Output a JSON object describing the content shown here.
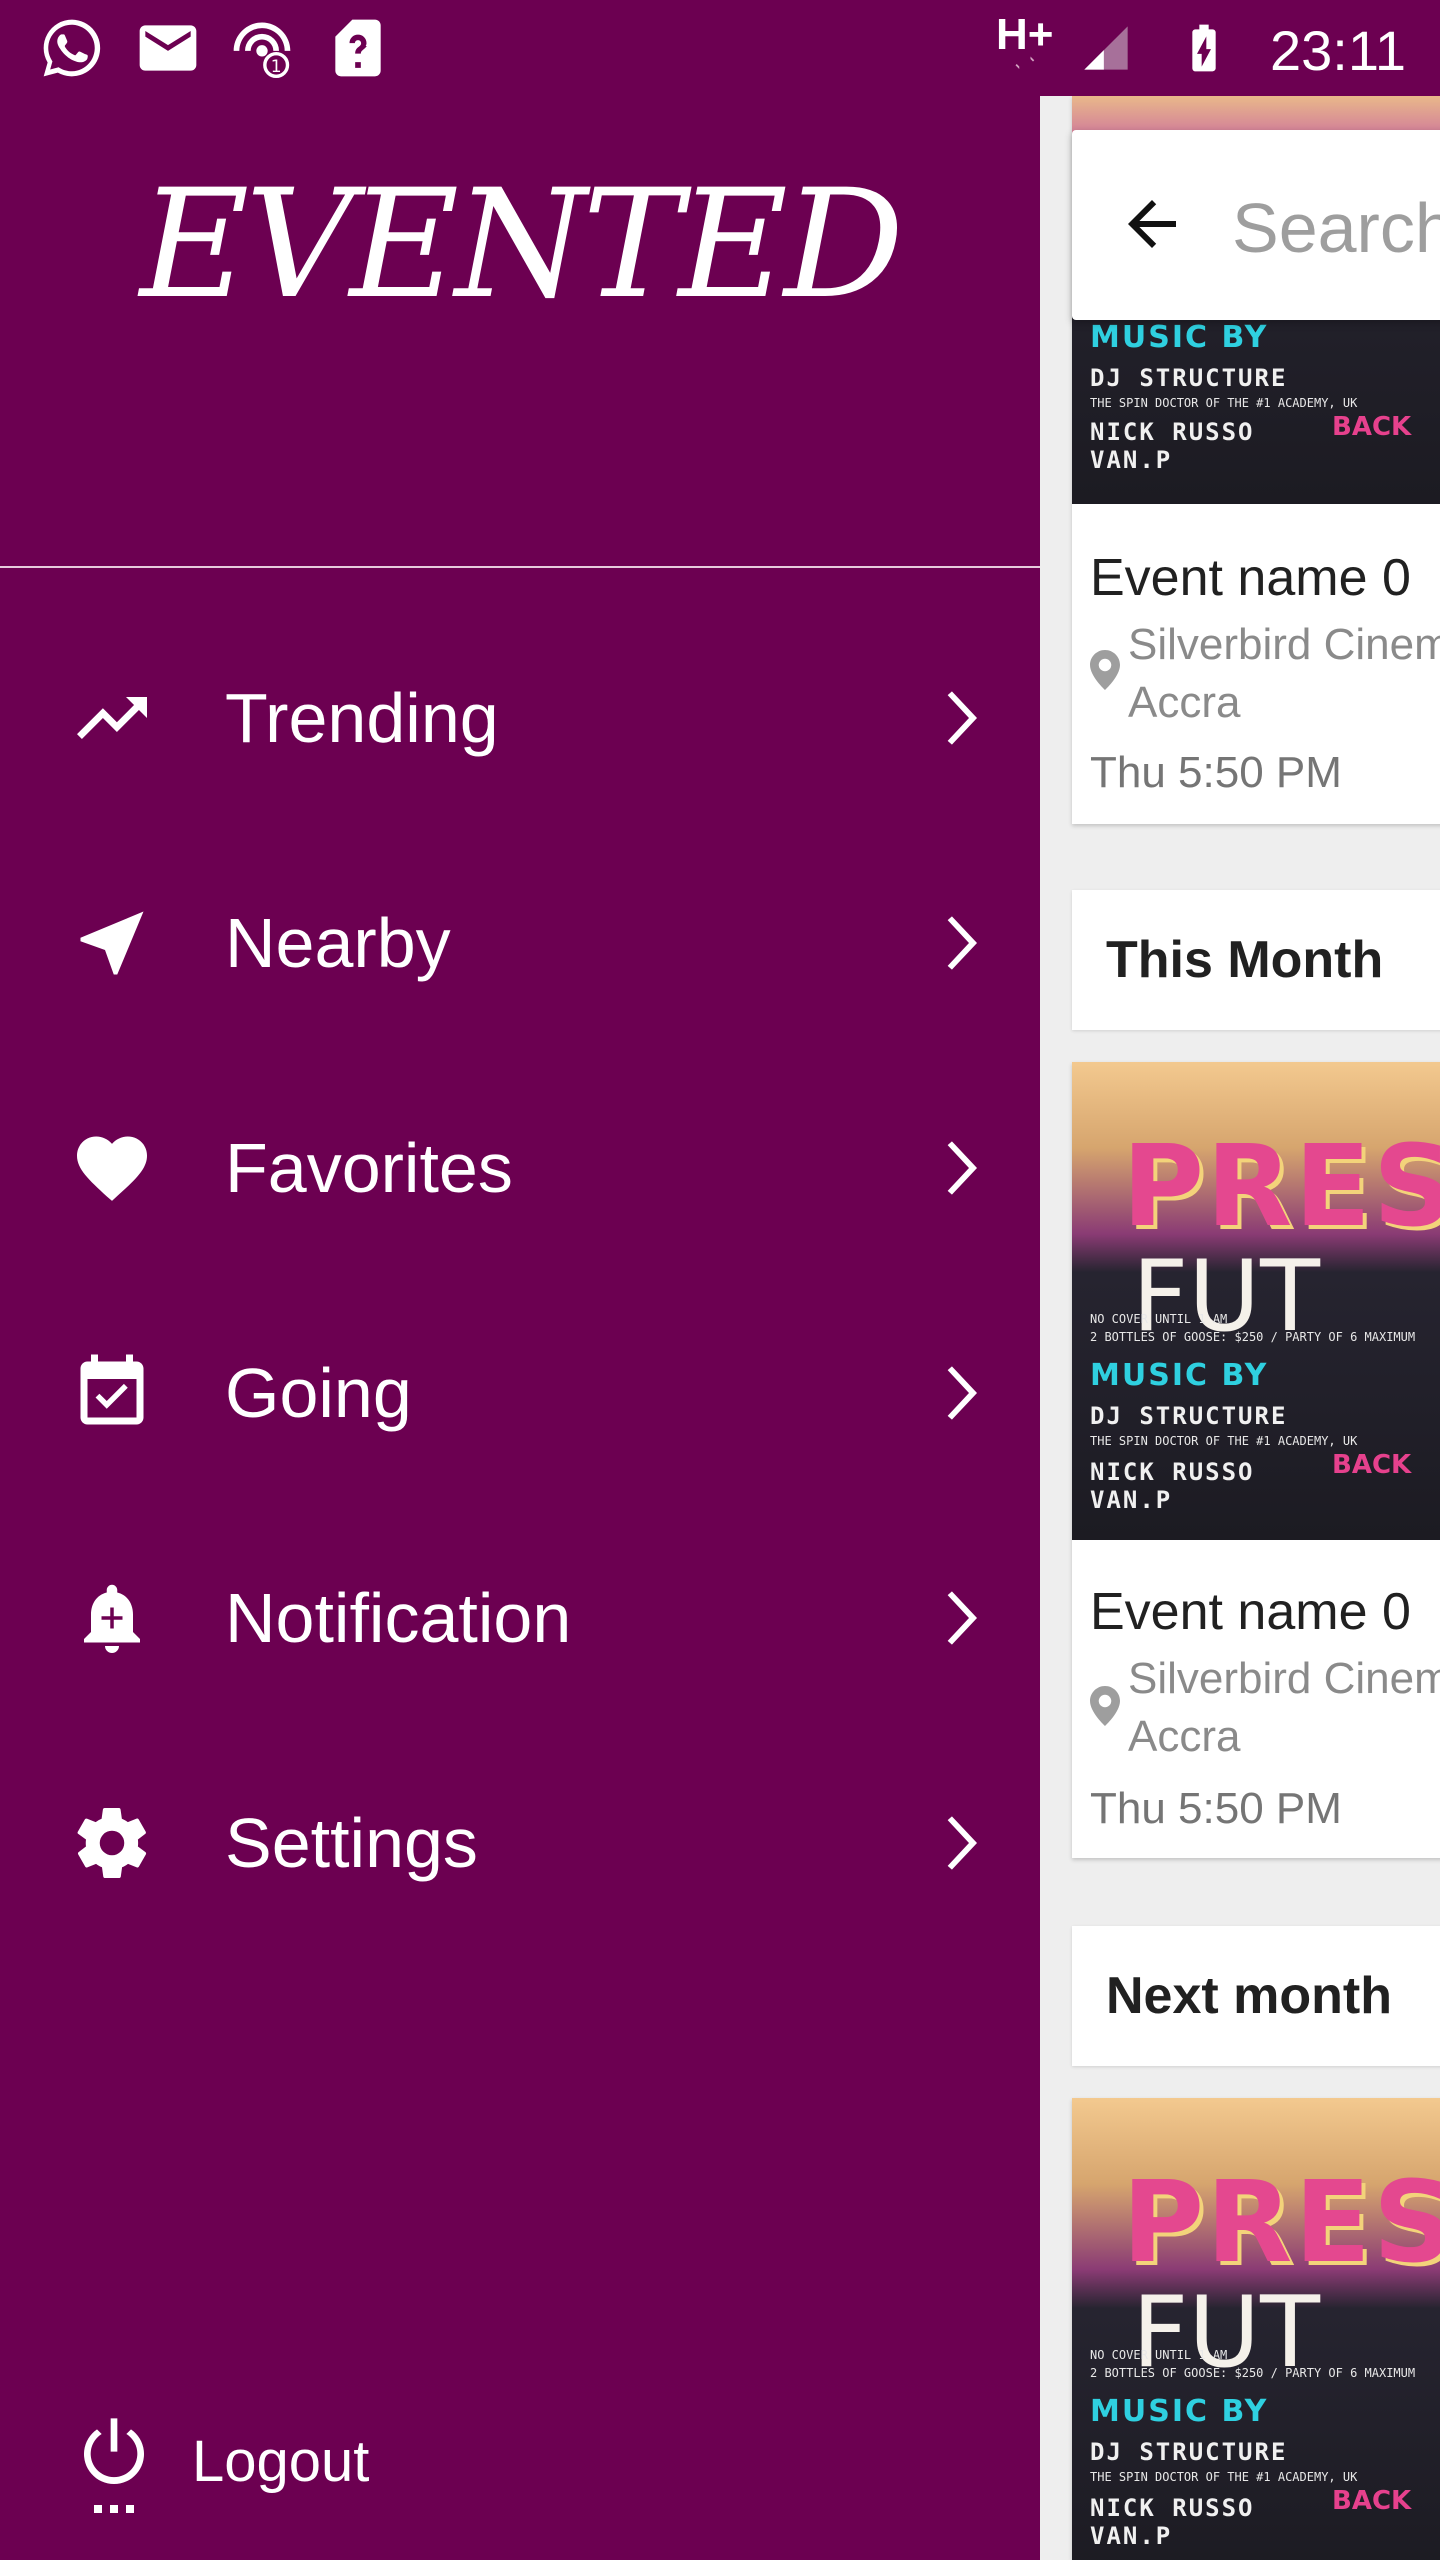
{
  "status_bar": {
    "time": "23:11",
    "network": "H+",
    "icons": [
      "whatsapp-icon",
      "mail-icon",
      "hotspot-icon",
      "sim-unknown-icon",
      "data-arrows-icon",
      "signal-icon",
      "battery-charging-icon"
    ]
  },
  "drawer": {
    "logo_text": "EVENTED",
    "menu": [
      {
        "label": "Trending",
        "icon": "trending-up-icon"
      },
      {
        "label": "Nearby",
        "icon": "navigation-icon"
      },
      {
        "label": "Favorites",
        "icon": "heart-icon"
      },
      {
        "label": "Going",
        "icon": "calendar-check-icon"
      },
      {
        "label": "Notification",
        "icon": "bell-plus-icon"
      },
      {
        "label": "Settings",
        "icon": "gear-icon"
      }
    ],
    "logout_label": "Logout",
    "background_color": "#6c0051"
  },
  "search": {
    "placeholder": "Search"
  },
  "events": {
    "card1": {
      "poster_music_by": "MUSIC BY",
      "poster_dj": "DJ STRUCTURE",
      "poster_subtitle": "THE SPIN DOCTOR OF THE #1 ACADEMY, UK",
      "poster_nick": "NICK RUSSO",
      "poster_vanp": "VAN.P",
      "poster_back": "BACK",
      "name": "Event name 0",
      "location_line1": "Silverbird Cinem",
      "location_line2": "Accra",
      "time": "Thu 5:50 PM"
    },
    "section_this_month": "This Month",
    "card2": {
      "poster_pres": "PRES",
      "poster_fut": "FUT",
      "poster_cover": "NO COVER UNTIL 1 AM",
      "poster_bottles": "2 BOTTLES OF GOOSE: $250 / PARTY OF 6 MAXIMUM",
      "poster_music_by": "MUSIC BY",
      "poster_dj": "DJ STRUCTURE",
      "poster_subtitle": "THE SPIN DOCTOR OF THE #1 ACADEMY, UK",
      "poster_nick": "NICK RUSSO",
      "poster_vanp": "VAN.P",
      "poster_back": "BACK",
      "name": "Event name 0",
      "location_line1": "Silverbird Cinem",
      "location_line2": "Accra",
      "time": "Thu 5:50 PM"
    },
    "section_next_month": "Next month",
    "card3": {
      "poster_pres": "PRES",
      "poster_fut": "FUT",
      "poster_cover": "NO COVER UNTIL 1 AM",
      "poster_bottles": "2 BOTTLES OF GOOSE: $250 / PARTY OF 6 MAXIMUM",
      "poster_music_by": "MUSIC BY",
      "poster_dj": "DJ STRUCTURE",
      "poster_subtitle": "THE SPIN DOCTOR OF THE #1 ACADEMY, UK",
      "poster_nick": "NICK RUSSO",
      "poster_vanp": "VAN.P",
      "poster_back": "BACK"
    }
  }
}
